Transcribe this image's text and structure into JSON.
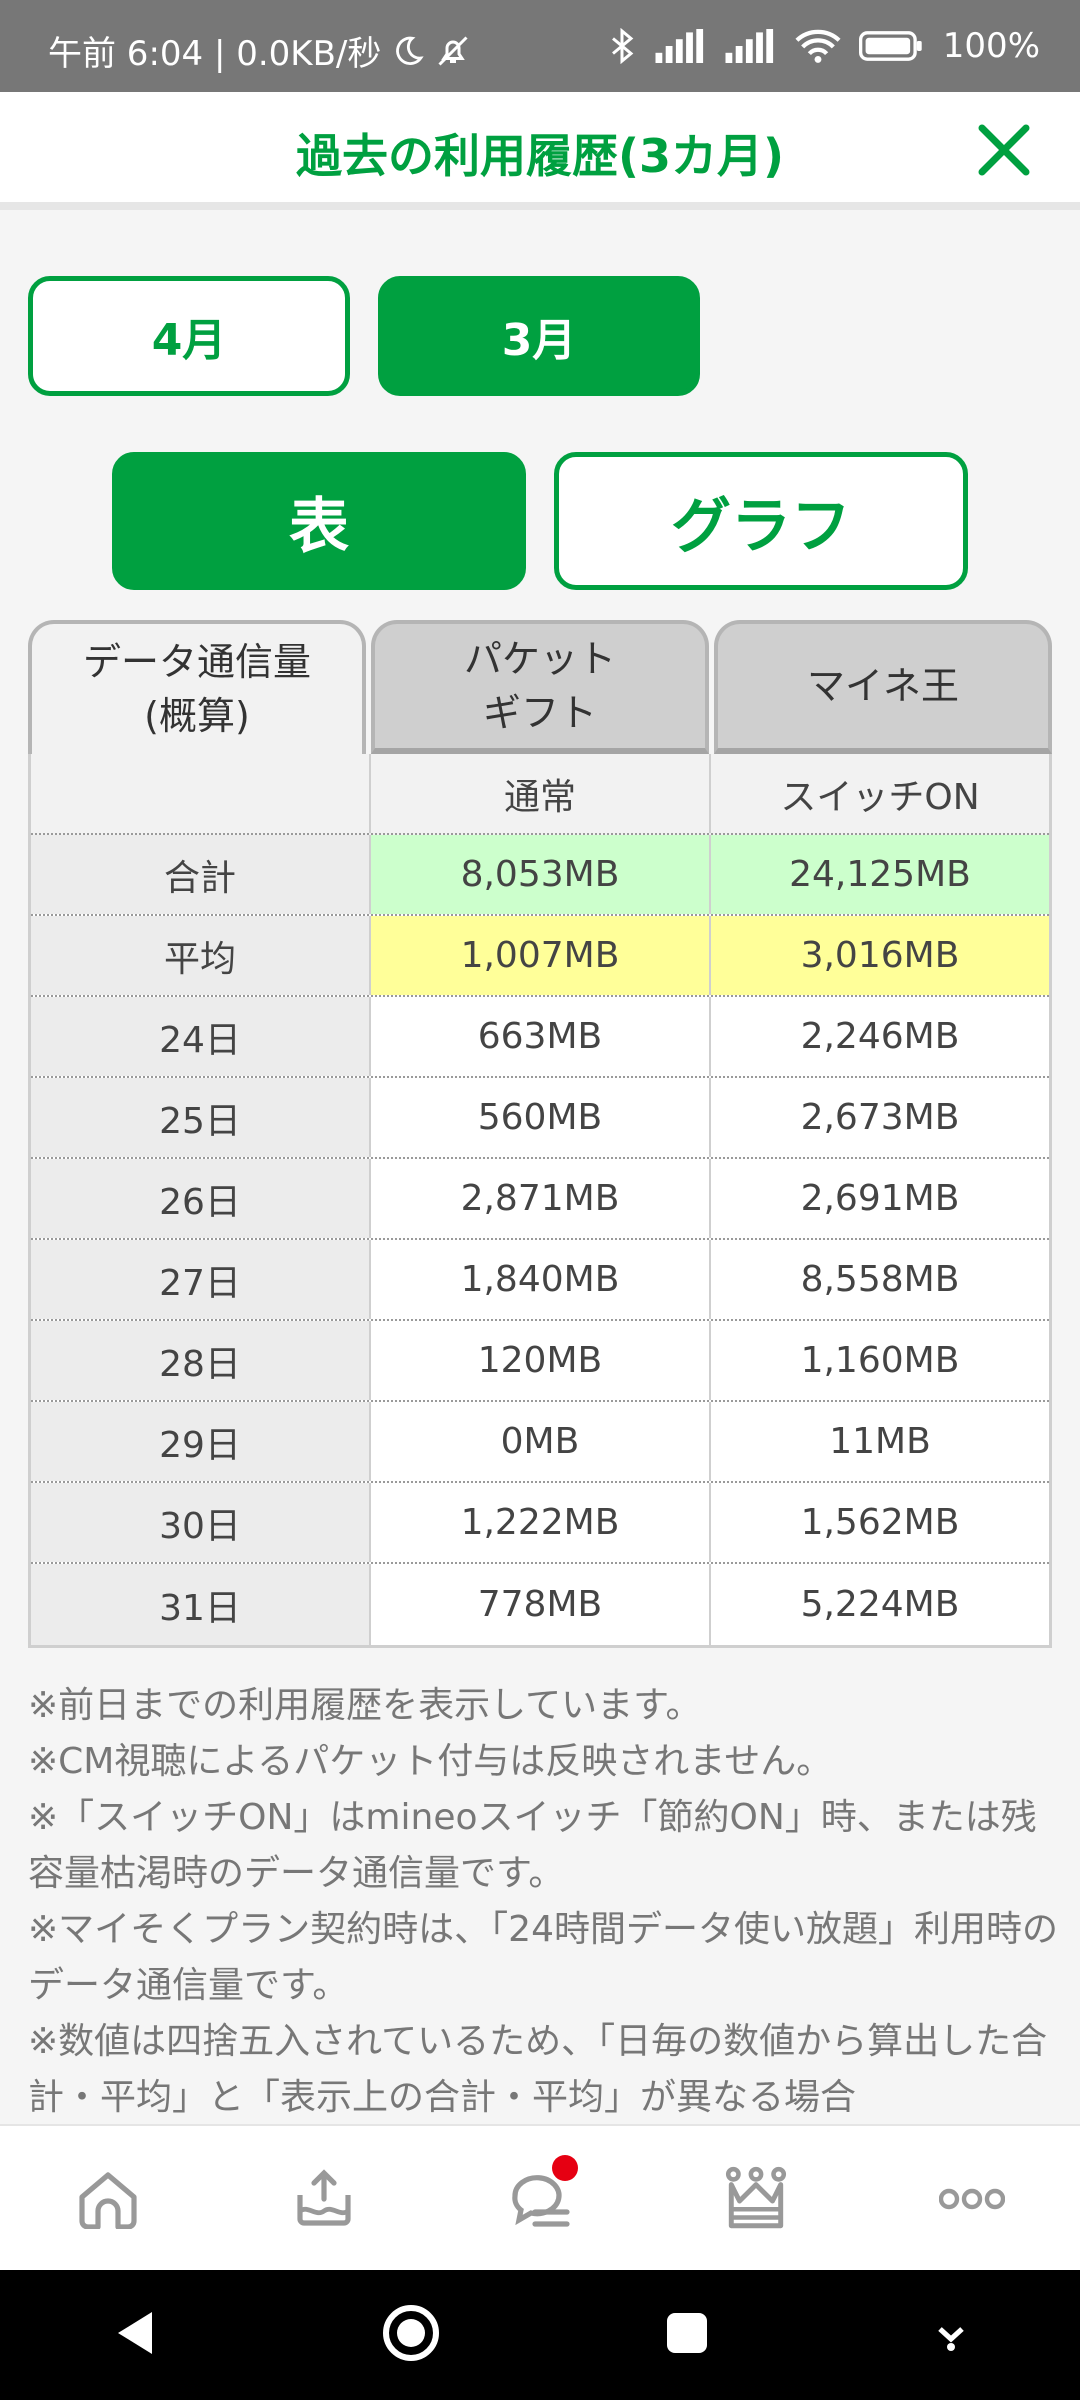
{
  "status_bar": {
    "time_text": "午前 6:04 | 0.0KB/秒",
    "battery": "100%"
  },
  "header": {
    "title": "過去の利用履歴(3カ月)"
  },
  "months": [
    {
      "label": "4月",
      "selected": false
    },
    {
      "label": "3月",
      "selected": true
    }
  ],
  "view_toggle": [
    {
      "label": "表",
      "selected": true
    },
    {
      "label": "グラフ",
      "selected": false
    }
  ],
  "tabs": [
    {
      "line1": "データ通信量",
      "line2": "(概算)",
      "active": true
    },
    {
      "line1": "パケット",
      "line2": "ギフト",
      "active": false
    },
    {
      "line1": "マイネ王",
      "line2": "",
      "active": false
    }
  ],
  "table": {
    "col_headers": [
      "",
      "通常",
      "スイッチON"
    ],
    "rows": [
      {
        "label": "合計",
        "normal": "8,053MB",
        "switch_on": "24,125MB"
      },
      {
        "label": "平均",
        "normal": "1,007MB",
        "switch_on": "3,016MB"
      },
      {
        "label": "24日",
        "normal": "663MB",
        "switch_on": "2,246MB"
      },
      {
        "label": "25日",
        "normal": "560MB",
        "switch_on": "2,673MB"
      },
      {
        "label": "26日",
        "normal": "2,871MB",
        "switch_on": "2,691MB"
      },
      {
        "label": "27日",
        "normal": "1,840MB",
        "switch_on": "8,558MB"
      },
      {
        "label": "28日",
        "normal": "120MB",
        "switch_on": "1,160MB"
      },
      {
        "label": "29日",
        "normal": "0MB",
        "switch_on": "11MB"
      },
      {
        "label": "30日",
        "normal": "1,222MB",
        "switch_on": "1,562MB"
      },
      {
        "label": "31日",
        "normal": "778MB",
        "switch_on": "5,224MB"
      }
    ]
  },
  "notes": [
    "※前日までの利用履歴を表示しています。",
    "※CM視聴によるパケット付与は反映されません。",
    "※「スイッチON」はmineoスイッチ「節約ON」時、または残容量枯渇時のデータ通信量です。",
    "※マイそくプラン契約時は、「24時間データ使い放題」利用時のデータ通信量です。",
    "※数値は四捨五入されているため、「日毎の数値から算出した合計・平均」と「表示上の合計・平均」が異なる場合"
  ],
  "bottom_nav": [
    {
      "icon": "home-icon"
    },
    {
      "icon": "data-transfer-icon"
    },
    {
      "icon": "chat-icon",
      "badge": true
    },
    {
      "icon": "crown-icon"
    },
    {
      "icon": "more-icon"
    }
  ],
  "colors": {
    "accent": "#00a040",
    "total_row": "#ccffcc",
    "average_row": "#ffff99",
    "badge": "#e60012"
  }
}
